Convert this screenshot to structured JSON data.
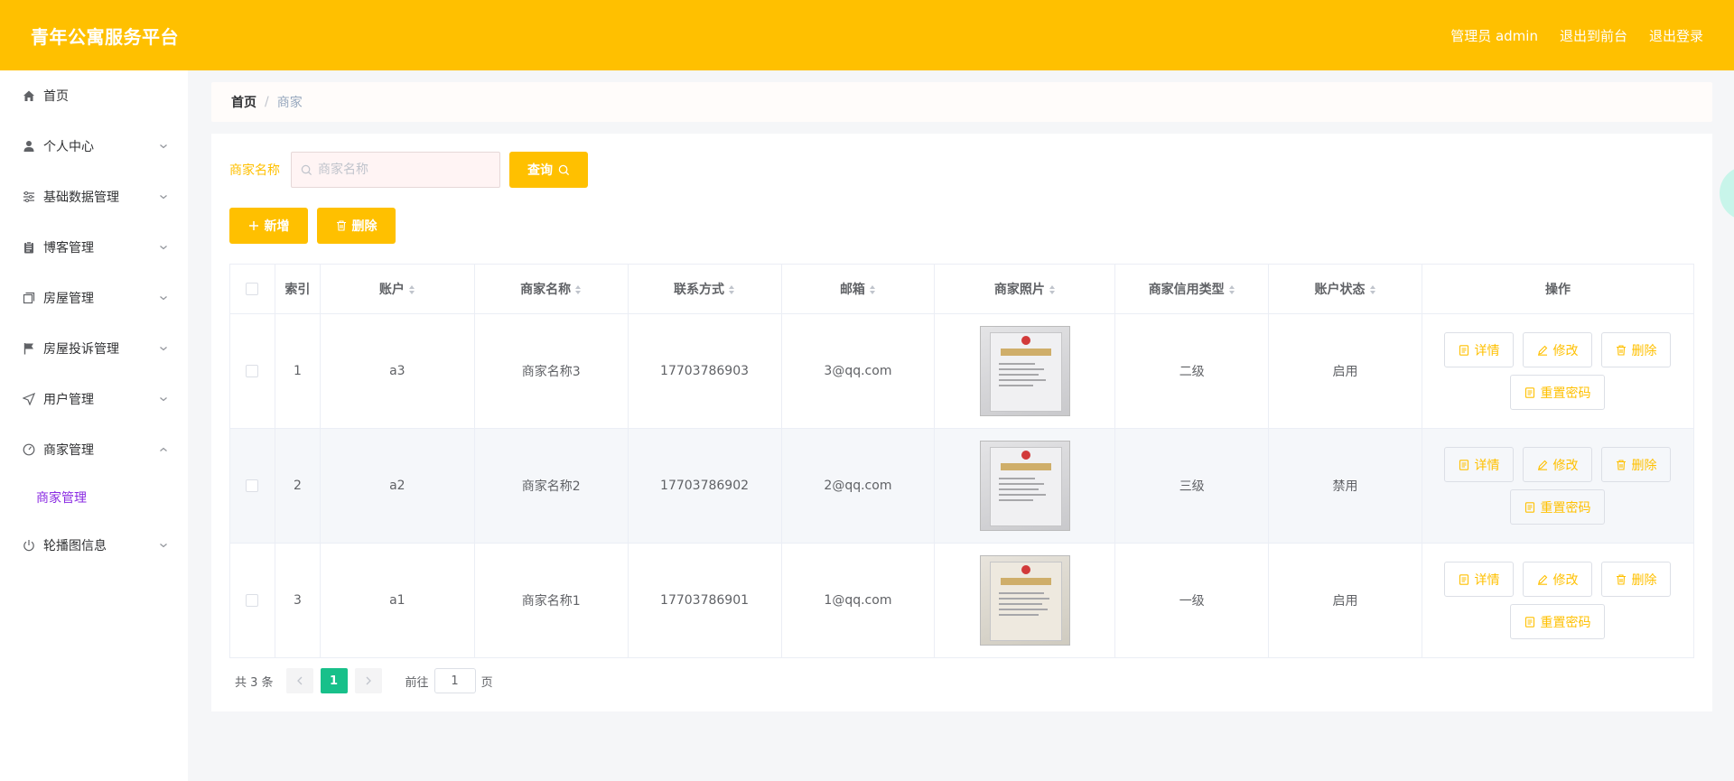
{
  "header": {
    "title": "青年公寓服务平台",
    "admin_label": "管理员 admin",
    "front_link": "退出到前台",
    "logout_link": "退出登录",
    "bg_color": "#ffc000"
  },
  "sidebar": {
    "items": [
      {
        "label": "首页",
        "icon": "home-icon"
      },
      {
        "label": "个人中心",
        "icon": "user-icon"
      },
      {
        "label": "基础数据管理",
        "icon": "sliders-icon"
      },
      {
        "label": "博客管理",
        "icon": "clipboard-icon"
      },
      {
        "label": "房屋管理",
        "icon": "copy-icon"
      },
      {
        "label": "房屋投诉管理",
        "icon": "flag-icon"
      },
      {
        "label": "用户管理",
        "icon": "send-icon"
      },
      {
        "label": "商家管理",
        "icon": "gauge-icon",
        "expanded": true
      },
      {
        "label": "轮播图信息",
        "icon": "power-icon"
      }
    ],
    "submenu": {
      "label": "商家管理",
      "color": "#8a2be2"
    }
  },
  "breadcrumb": {
    "home": "首页",
    "separator": "/",
    "current": "商家"
  },
  "search": {
    "label": "商家名称",
    "placeholder": "商家名称",
    "value": "",
    "query_button": "查询"
  },
  "actions": {
    "add_button": "新增",
    "delete_button": "删除"
  },
  "table": {
    "columns": [
      "索引",
      "账户",
      "商家名称",
      "联系方式",
      "邮箱",
      "商家照片",
      "商家信用类型",
      "账户状态",
      "操作"
    ],
    "rows": [
      {
        "index": "1",
        "account": "a3",
        "name": "商家名称3",
        "phone": "17703786903",
        "email": "3@qq.com",
        "credit": "二级",
        "status": "启用"
      },
      {
        "index": "2",
        "account": "a2",
        "name": "商家名称2",
        "phone": "17703786902",
        "email": "2@qq.com",
        "credit": "三级",
        "status": "禁用"
      },
      {
        "index": "3",
        "account": "a1",
        "name": "商家名称1",
        "phone": "17703786901",
        "email": "1@qq.com",
        "credit": "一级",
        "status": "启用"
      }
    ],
    "row_actions": {
      "detail": "详情",
      "edit": "修改",
      "delete": "删除",
      "reset_password": "重置密码"
    }
  },
  "pagination": {
    "total_text": "共 3 条",
    "current_page": "1",
    "goto_prefix": "前往",
    "goto_value": "1",
    "goto_suffix": "页",
    "active_color": "#18c08a"
  }
}
